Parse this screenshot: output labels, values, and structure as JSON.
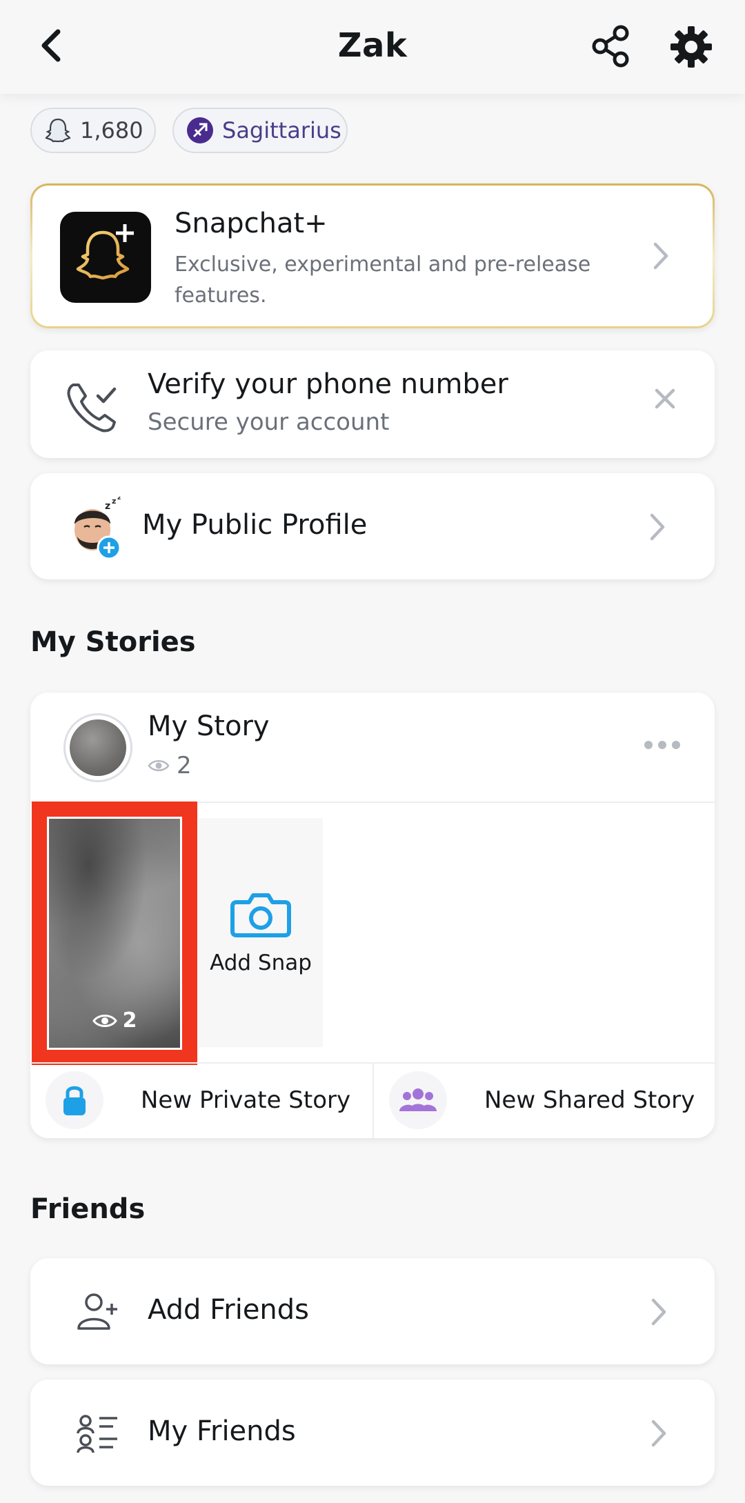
{
  "header": {
    "title": "Zak",
    "back_icon": "chevron-left-icon",
    "share_icon": "share-icon",
    "settings_icon": "gear-icon"
  },
  "chips": {
    "score": "1,680",
    "zodiac": "Sagittarius"
  },
  "snapchat_plus": {
    "title": "Snapchat+",
    "subtitle": "Exclusive, experimental and pre-release features."
  },
  "verify_phone": {
    "title": "Verify your phone number",
    "subtitle": "Secure your account"
  },
  "public_profile": {
    "label": "My Public Profile"
  },
  "my_stories": {
    "section_title": "My Stories",
    "story_title": "My Story",
    "story_views": "2",
    "snap_views": "2",
    "add_snap_label": "Add Snap",
    "new_private_story": "New Private Story",
    "new_shared_story": "New Shared Story"
  },
  "friends": {
    "section_title": "Friends",
    "add_friends": "Add Friends",
    "my_friends": "My Friends"
  },
  "colors": {
    "background": "#f7f7f8",
    "highlight_red": "#f0361e",
    "camera_blue": "#1ea0e6",
    "group_purple": "#a374d8",
    "zodiac_purple": "#4a3d88"
  }
}
